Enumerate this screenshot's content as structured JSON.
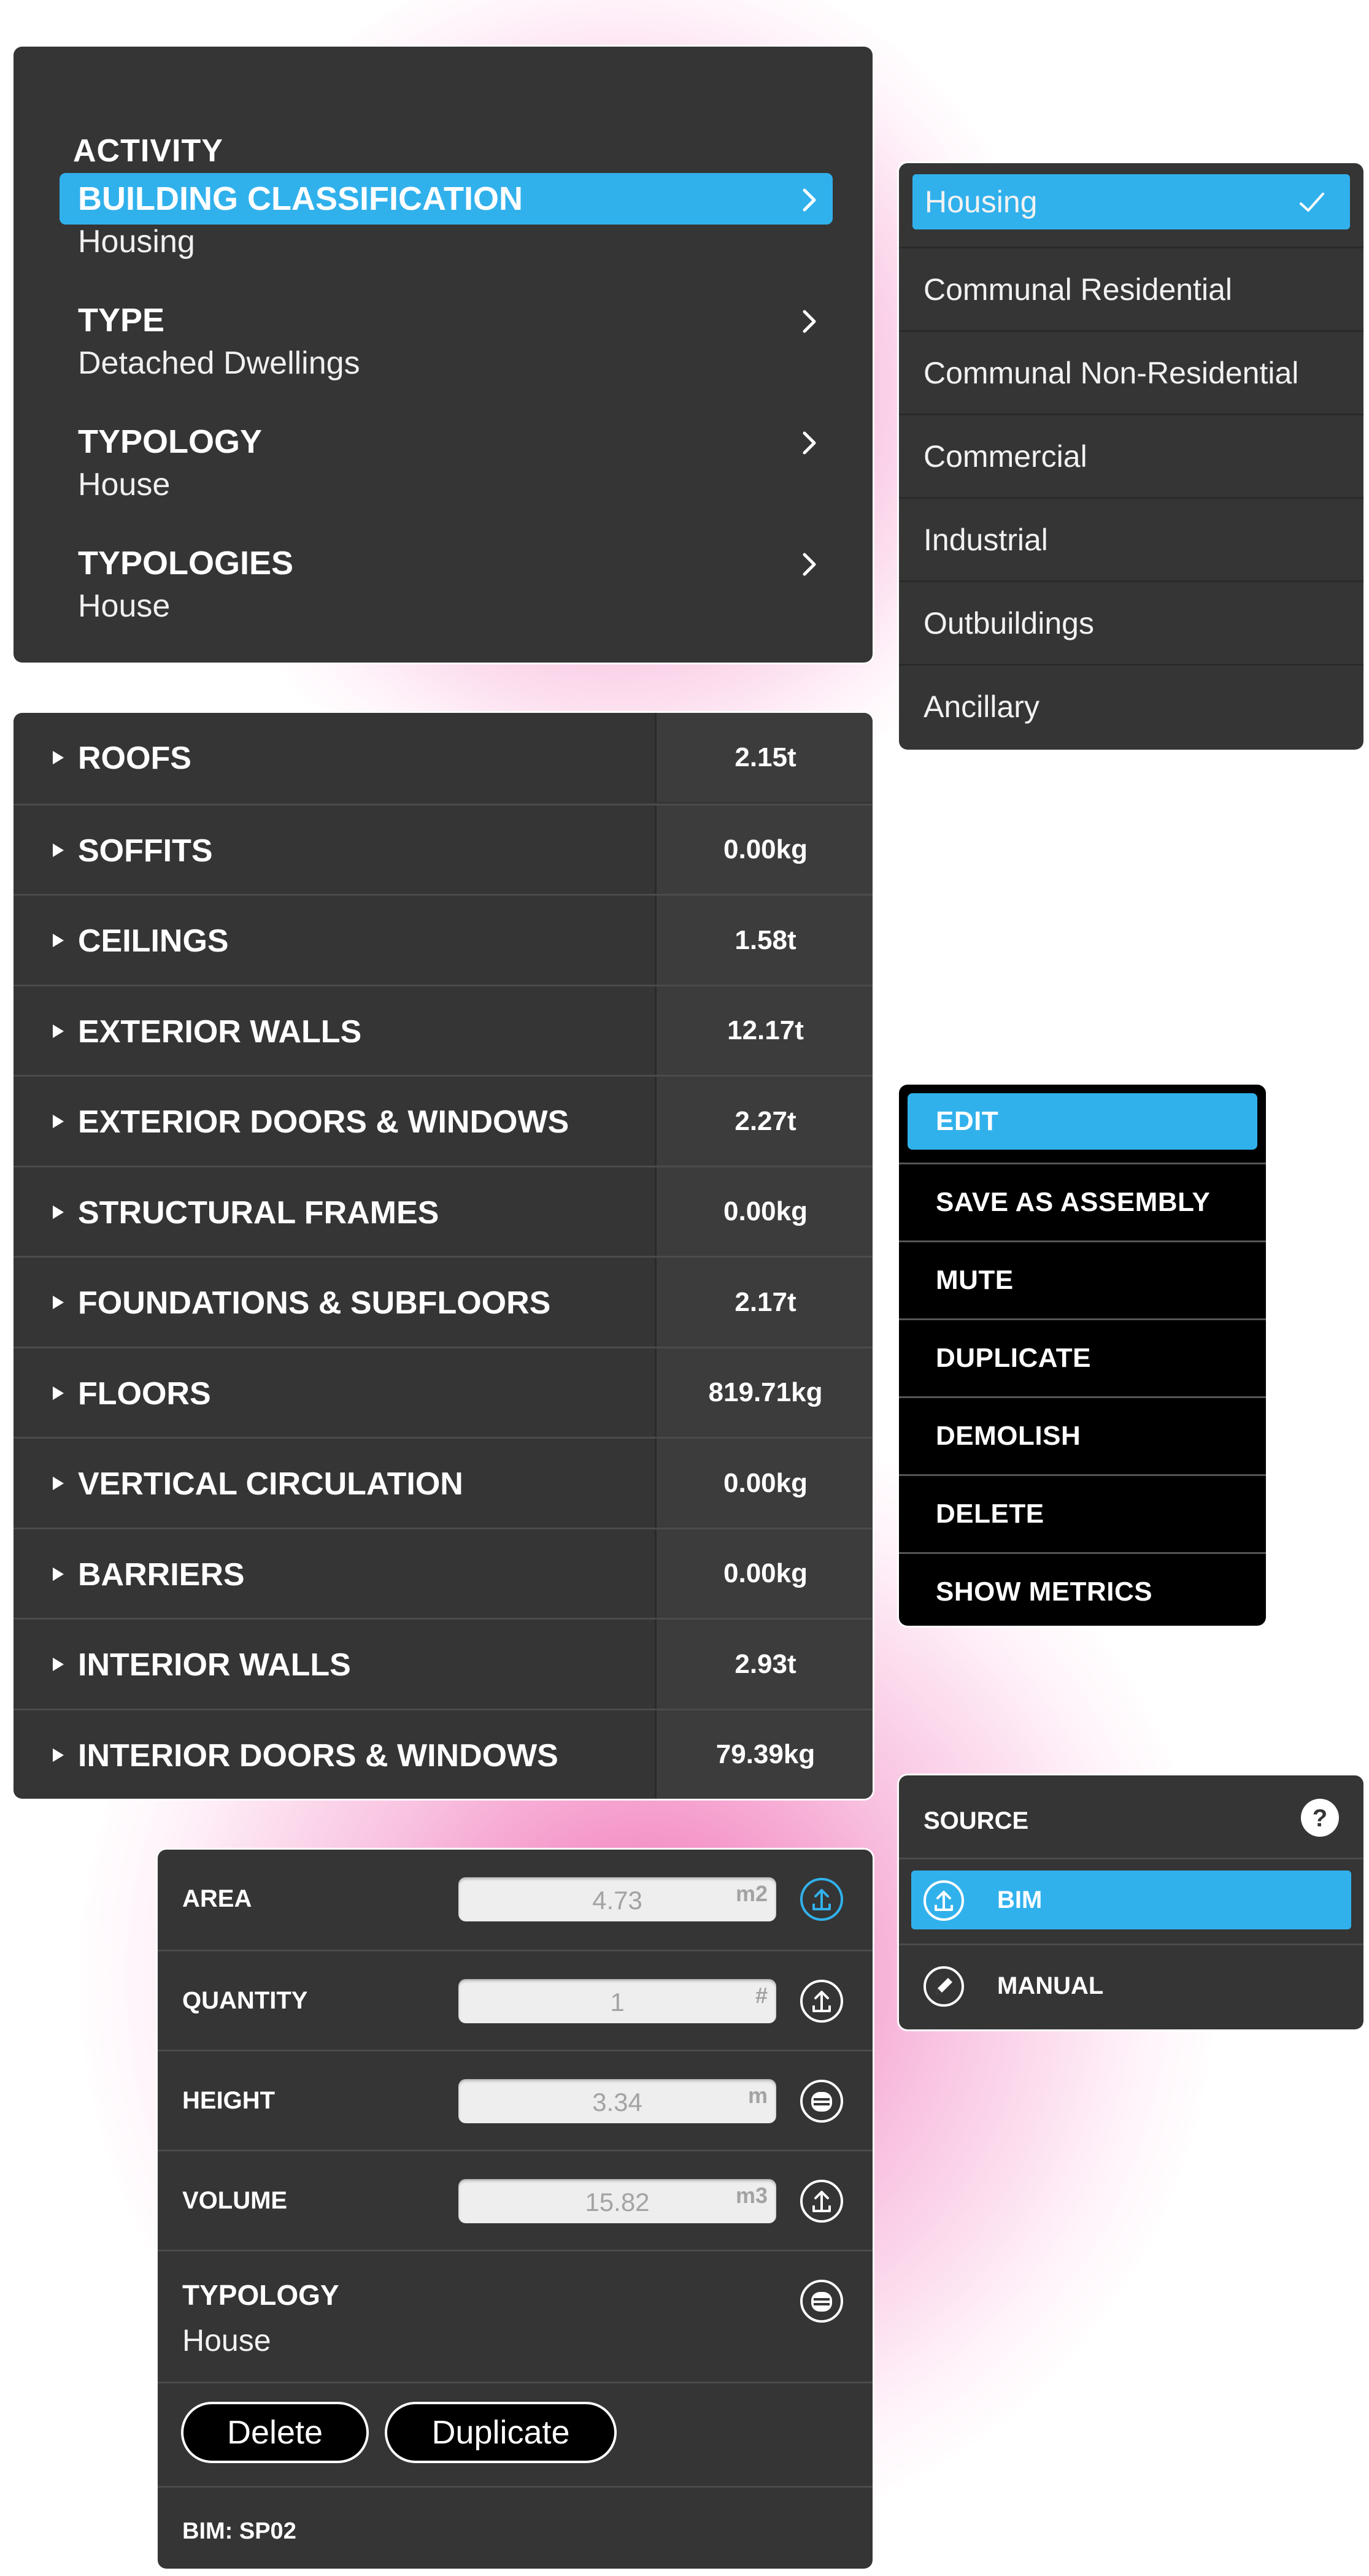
{
  "colors": {
    "panel": "#353535",
    "accent": "#31b1ec",
    "menu_bg": "#000000",
    "glow": "#ee56a7"
  },
  "activity": {
    "title": "ACTIVITY",
    "rows": [
      {
        "label": "BUILDING CLASSIFICATION",
        "value": "Housing",
        "selected": true
      },
      {
        "label": "TYPE",
        "value": "Detached Dwellings"
      },
      {
        "label": "TYPOLOGY",
        "value": "House"
      },
      {
        "label": "TYPOLOGIES",
        "value": "House"
      }
    ]
  },
  "classification": {
    "items": [
      "Housing",
      "Communal Residential",
      "Communal Non-Residential",
      "Commercial",
      "Industrial",
      "Outbuildings",
      "Ancillary"
    ],
    "selected": "Housing"
  },
  "materials": {
    "rows": [
      {
        "name": "ROOFS",
        "value": "2.15t"
      },
      {
        "name": "SOFFITS",
        "value": "0.00kg"
      },
      {
        "name": "CEILINGS",
        "value": "1.58t"
      },
      {
        "name": "EXTERIOR WALLS",
        "value": "12.17t"
      },
      {
        "name": "EXTERIOR DOORS & WINDOWS",
        "value": "2.27t"
      },
      {
        "name": "STRUCTURAL FRAMES",
        "value": "0.00kg"
      },
      {
        "name": "FOUNDATIONS & SUBFLOORS",
        "value": "2.17t"
      },
      {
        "name": "FLOORS",
        "value": "819.71kg"
      },
      {
        "name": "VERTICAL CIRCULATION",
        "value": "0.00kg"
      },
      {
        "name": "BARRIERS",
        "value": "0.00kg"
      },
      {
        "name": "INTERIOR WALLS",
        "value": "2.93t"
      },
      {
        "name": "INTERIOR DOORS & WINDOWS",
        "value": "79.39kg"
      }
    ]
  },
  "context_menu": {
    "items": [
      "EDIT",
      "SAVE AS ASSEMBLY",
      "MUTE",
      "DUPLICATE",
      "DEMOLISH",
      "DELETE",
      "SHOW METRICS"
    ],
    "selected": "EDIT"
  },
  "source": {
    "title": "SOURCE",
    "help_icon": "question-circle-icon",
    "options": [
      {
        "label": "BIM",
        "icon": "upload-circle-icon",
        "selected": true
      },
      {
        "label": "MANUAL",
        "icon": "pencil-circle-icon"
      }
    ]
  },
  "properties": {
    "fields": [
      {
        "label": "AREA",
        "value": "4.73",
        "unit": "m2",
        "icon": "upload-icon",
        "icon_active": true
      },
      {
        "label": "QUANTITY",
        "value": "1",
        "unit": "#",
        "icon": "upload-icon"
      },
      {
        "label": "HEIGHT",
        "value": "3.34",
        "unit": "m",
        "icon": "db-icon"
      },
      {
        "label": "VOLUME",
        "value": "15.82",
        "unit": "m3",
        "icon": "upload-icon"
      }
    ],
    "typology": {
      "label": "TYPOLOGY",
      "value": "House",
      "icon": "db-icon"
    },
    "buttons": {
      "delete": "Delete",
      "duplicate": "Duplicate"
    },
    "footer": "BIM: SP02"
  }
}
